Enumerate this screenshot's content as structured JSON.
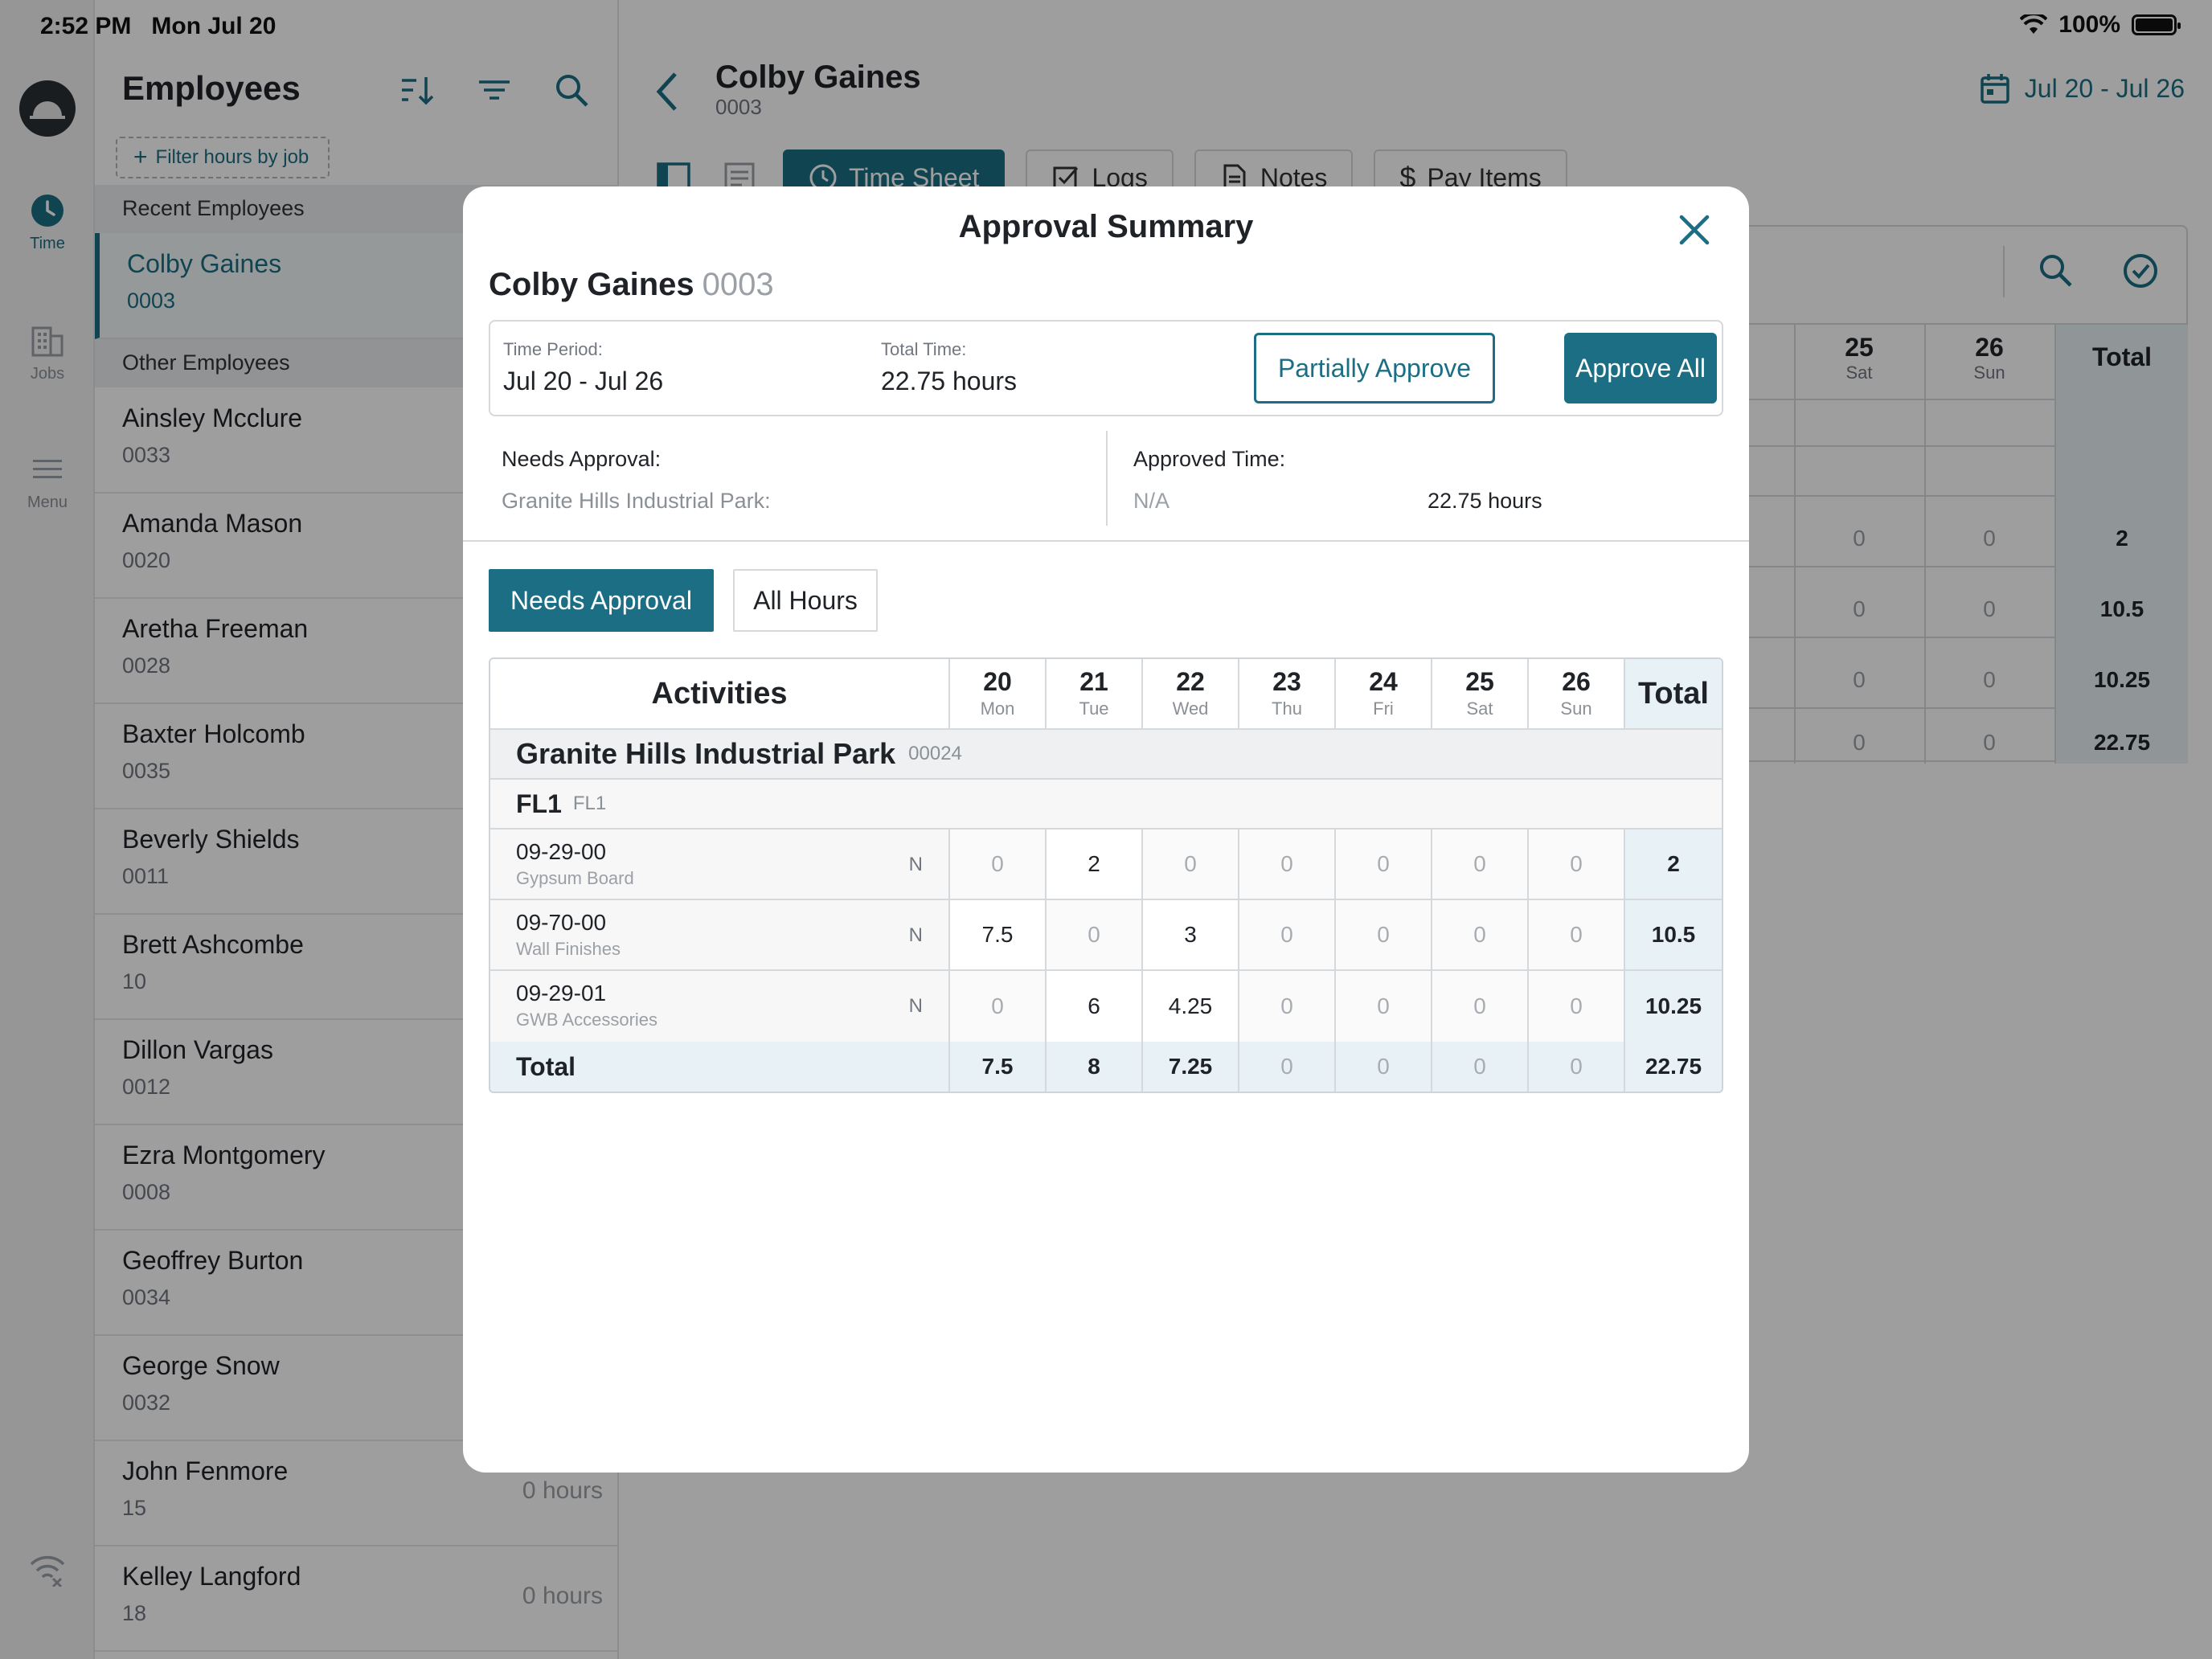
{
  "status_bar": {
    "time": "2:52 PM",
    "date": "Mon Jul 20",
    "battery": "100%"
  },
  "rail": {
    "items": [
      {
        "label": "Time",
        "icon": "clock-icon"
      },
      {
        "label": "Jobs",
        "icon": "building-icon"
      },
      {
        "label": "Menu",
        "icon": "hamburger-icon"
      }
    ]
  },
  "employees_panel": {
    "title": "Employees",
    "filter_chip": "Filter hours by job",
    "recent_header": "Recent Employees",
    "other_header": "Other Employees",
    "recent": [
      {
        "name": "Colby Gaines",
        "id": "0003"
      }
    ],
    "others": [
      {
        "name": "Ainsley Mcclure",
        "id": "0033",
        "hours": ""
      },
      {
        "name": "Amanda Mason",
        "id": "0020",
        "hours": ""
      },
      {
        "name": "Aretha Freeman",
        "id": "0028",
        "hours": ""
      },
      {
        "name": "Baxter Holcomb",
        "id": "0035",
        "hours": ""
      },
      {
        "name": "Beverly Shields",
        "id": "0011",
        "hours": ""
      },
      {
        "name": "Brett Ashcombe",
        "id": "10",
        "hours": ""
      },
      {
        "name": "Dillon Vargas",
        "id": "0012",
        "hours": ""
      },
      {
        "name": "Ezra Montgomery",
        "id": "0008",
        "hours": ""
      },
      {
        "name": "Geoffrey Burton",
        "id": "0034",
        "hours": ""
      },
      {
        "name": "George Snow",
        "id": "0032",
        "hours": ""
      },
      {
        "name": "John Fenmore",
        "id": "15",
        "hours": "0 hours"
      },
      {
        "name": "Kelley Langford",
        "id": "18",
        "hours": "0 hours"
      }
    ]
  },
  "main": {
    "employee_name": "Colby Gaines",
    "employee_id": "0003",
    "date_range": "Jul 20 - Jul 26",
    "tabs": [
      "Time Sheet",
      "Logs",
      "Notes",
      "Pay Items"
    ],
    "bg_days": [
      {
        "d": "25",
        "w": "Sat"
      },
      {
        "d": "26",
        "w": "Sun"
      }
    ],
    "bg_total_label": "Total",
    "bg_rows": [
      {
        "sat": "0",
        "sun": "0",
        "total": "2"
      },
      {
        "sat": "0",
        "sun": "0",
        "total": "10.5"
      },
      {
        "sat": "0",
        "sun": "0",
        "total": "10.25"
      },
      {
        "sat": "0",
        "sun": "0",
        "total": "22.75"
      }
    ]
  },
  "modal": {
    "title": "Approval Summary",
    "employee_name": "Colby Gaines",
    "employee_id": "0003",
    "time_period_label": "Time Period:",
    "time_period": "Jul 20 - Jul 26",
    "total_time_label": "Total Time:",
    "total_time": "22.75 hours",
    "partially_approve": "Partially Approve",
    "approve_all": "Approve All",
    "needs_approval_label": "Needs Approval:",
    "needs_job": "Granite Hills Industrial Park:",
    "needs_hours": "22.75 hours",
    "approved_time_label": "Approved Time:",
    "approved_time": "N/A",
    "seg_needs": "Needs Approval",
    "seg_all": "All Hours",
    "grid": {
      "activities_label": "Activities",
      "total_label": "Total",
      "days": [
        {
          "d": "20",
          "w": "Mon"
        },
        {
          "d": "21",
          "w": "Tue"
        },
        {
          "d": "22",
          "w": "Wed"
        },
        {
          "d": "23",
          "w": "Thu"
        },
        {
          "d": "24",
          "w": "Fri"
        },
        {
          "d": "25",
          "w": "Sat"
        },
        {
          "d": "26",
          "w": "Sun"
        }
      ],
      "job_name": "Granite Hills Industrial Park",
      "job_code": "00024",
      "floor_name": "FL1",
      "floor_code": "FL1",
      "items": [
        {
          "code": "09-29-00",
          "desc": "Gypsum Board",
          "flag": "N",
          "values": [
            "0",
            "2",
            "0",
            "0",
            "0",
            "0",
            "0"
          ],
          "total": "2"
        },
        {
          "code": "09-70-00",
          "desc": "Wall Finishes",
          "flag": "N",
          "values": [
            "7.5",
            "0",
            "3",
            "0",
            "0",
            "0",
            "0"
          ],
          "total": "10.5"
        },
        {
          "code": "09-29-01",
          "desc": "GWB Accessories",
          "flag": "N",
          "values": [
            "0",
            "6",
            "4.25",
            "0",
            "0",
            "0",
            "0"
          ],
          "total": "10.25"
        }
      ],
      "totals": {
        "label": "Total",
        "values": [
          "7.5",
          "8",
          "7.25",
          "0",
          "0",
          "0",
          "0"
        ],
        "total": "22.75"
      }
    }
  }
}
